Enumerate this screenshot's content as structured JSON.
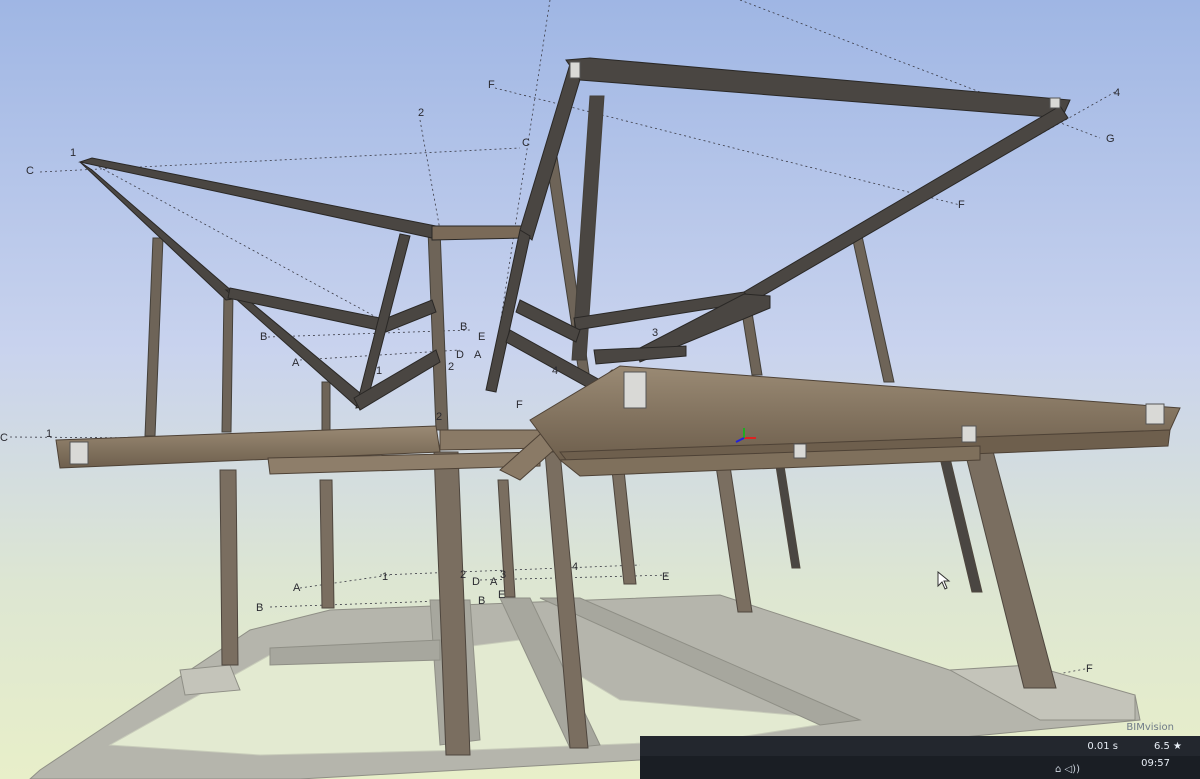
{
  "viewer": {
    "watermark": "BIMvision",
    "render_time": "0.01 s",
    "fps": "6.5 ★",
    "clock_time": "09:57",
    "clock_date": "",
    "tray": "⌂ ◁))"
  },
  "grid_labels": {
    "c1": "C",
    "c2": "C",
    "c3": "C",
    "n1a": "1",
    "n1b": "1",
    "n1c": "1",
    "n1d": "1",
    "n2a": "2",
    "n2b": "2",
    "n2c": "2",
    "n2d": "2",
    "n3a": "3",
    "n3b": "3",
    "n4a": "4",
    "n4b": "4",
    "n4c": "4",
    "b1": "B",
    "b2": "B",
    "b3": "B",
    "b4": "B",
    "a1": "A",
    "a2": "A",
    "a3": "A",
    "a4": "A",
    "d1": "D",
    "d2": "D",
    "e1": "E",
    "e2": "E",
    "f1": "F",
    "f2": "F",
    "f3": "F",
    "f4": "F",
    "g1": "G"
  },
  "colors": {
    "sky_top": "#9fb6e4",
    "sky_bottom": "#e4ecc8",
    "steel_dark": "#4a4642",
    "steel_brown": "#7a6a58",
    "foundation": "#b5b5ac"
  }
}
